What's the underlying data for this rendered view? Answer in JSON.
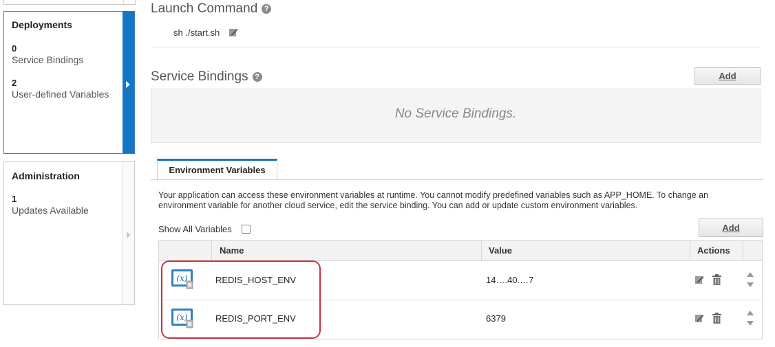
{
  "sidebar": {
    "deployments": {
      "title": "Deployments",
      "service_bindings_count": "0",
      "service_bindings_label": "Service Bindings",
      "user_vars_count": "2",
      "user_vars_label": "User-defined Variables"
    },
    "administration": {
      "title": "Administration",
      "updates_count": "1",
      "updates_label": "Updates Available"
    }
  },
  "launch_command": {
    "title": "Launch Command",
    "value": "sh ./start.sh"
  },
  "service_bindings": {
    "title": "Service Bindings",
    "add_label": "Add",
    "empty_text": "No Service Bindings."
  },
  "env_vars": {
    "tab_label": "Environment Variables",
    "description": "Your application can access these environment variables at runtime. You cannot modify predefined variables such as APP_HOME. To change an environment variable for another cloud service, edit the service binding. You can add or update custom environment variables.",
    "show_all_label": "Show All Variables",
    "add_label": "Add",
    "columns": {
      "name": "Name",
      "value": "Value",
      "actions": "Actions"
    },
    "rows": [
      {
        "name": "REDIS_HOST_ENV",
        "value": "14….40.…7"
      },
      {
        "name": "REDIS_PORT_ENV",
        "value": "6379"
      }
    ]
  },
  "colors": {
    "accent": "#1476c6",
    "highlight": "#c0363d"
  }
}
